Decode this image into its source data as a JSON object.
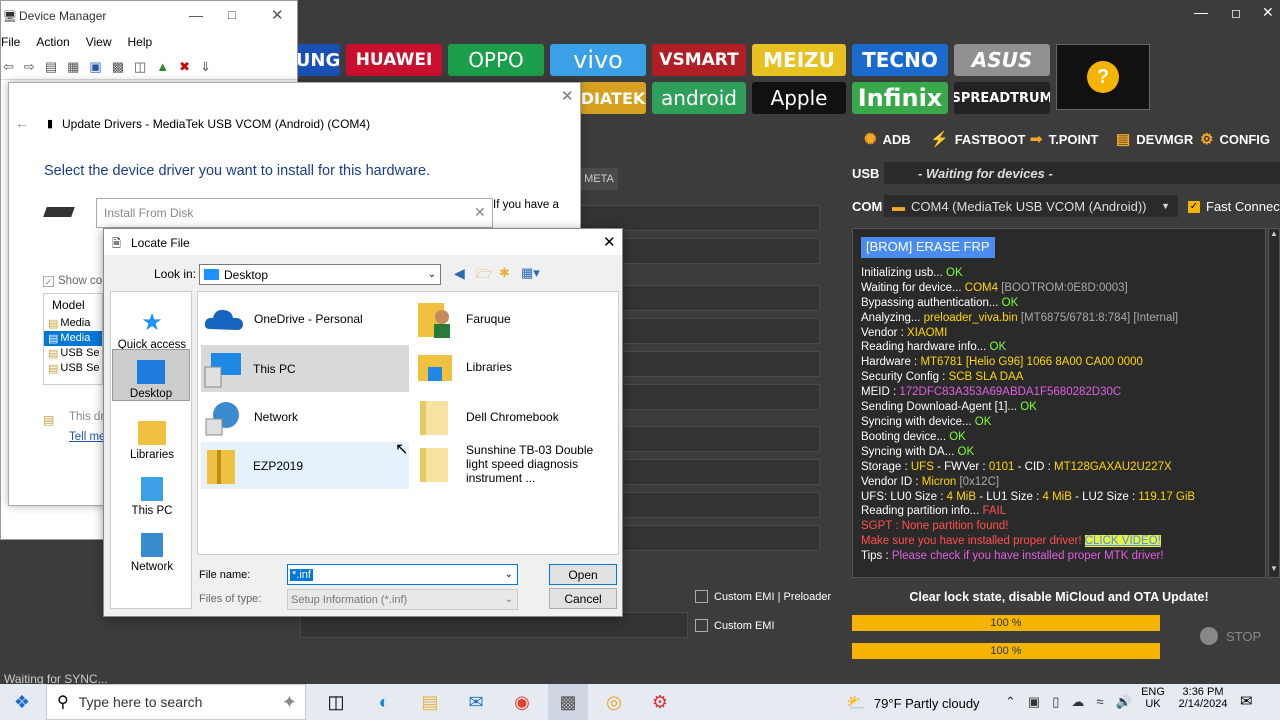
{
  "tool": {
    "brands": [
      "UNG",
      "HUAWEI",
      "OPPO",
      "vivo",
      "VSMART",
      "MEIZU",
      "TECNO",
      "ASUS",
      "DIATEK",
      "android",
      "Apple",
      "Infinix",
      "SPREADTRUM"
    ],
    "help_symbol": "?",
    "tabs": {
      "adb": "ADB",
      "fastboot": "FASTBOOT",
      "tpoint": "T.POINT",
      "devmgr": "DEVMGR",
      "config": "CONFIG"
    },
    "usb_label": "USB",
    "usb_value": "- Waiting for devices -",
    "com_label": "COM",
    "com_value": "COM4 (MediaTek USB VCOM (Android))",
    "fast_connect": "Fast Connect",
    "meta_tab": "META",
    "erase_button": "[BROM] ERASE FRP",
    "custom_emi_preloader": "Custom EMI | Preloader",
    "custom_emi": "Custom EMI",
    "clear_lock_text": "Clear lock state, disable MiCloud and OTA Update!",
    "progress1": "100 %",
    "progress2": "100 %",
    "stop_label": "STOP",
    "status_text": "Waiting for SYNC...",
    "log": [
      [
        [
          "Initializing usb... ",
          ""
        ],
        [
          "OK",
          "ok"
        ]
      ],
      [
        [
          "Waiting for device... ",
          ""
        ],
        [
          "COM4 ",
          "y"
        ],
        [
          "[BOOTROM:0E8D:0003]",
          "g"
        ]
      ],
      [
        [
          "Bypassing authentication... ",
          ""
        ],
        [
          "OK",
          "ok"
        ]
      ],
      [
        [
          "Analyzing... ",
          ""
        ],
        [
          "preloader_viva.bin ",
          "y"
        ],
        [
          "[MT6875/6781:8:784] [Internal]",
          "g"
        ]
      ],
      [
        [
          "Vendor : ",
          ""
        ],
        [
          "XIAOMI",
          "y"
        ]
      ],
      [
        [
          "Reading hardware info... ",
          ""
        ],
        [
          "OK",
          "ok"
        ]
      ],
      [
        [
          "  Hardware : ",
          ""
        ],
        [
          "MT6781 [Helio G96] 1066 8A00 CA00 0000",
          "y"
        ]
      ],
      [
        [
          "  Security Config : ",
          ""
        ],
        [
          "SCB SLA DAA",
          "y"
        ]
      ],
      [
        [
          "  MEID : ",
          ""
        ],
        [
          "172DFC83A353A69ABDA1F5680282D30C",
          "pk"
        ]
      ],
      [
        [
          "Sending Download-Agent [1]... ",
          ""
        ],
        [
          "OK",
          "ok"
        ]
      ],
      [
        [
          "Syncing with device... ",
          ""
        ],
        [
          "OK",
          "ok"
        ]
      ],
      [
        [
          "Booting device... ",
          ""
        ],
        [
          "OK",
          "ok"
        ]
      ],
      [
        [
          "Syncing with DA... ",
          ""
        ],
        [
          "OK",
          "ok"
        ]
      ],
      [
        [
          "  Storage : ",
          ""
        ],
        [
          "UFS",
          "y"
        ],
        [
          " - FWVer : ",
          ""
        ],
        [
          "0101",
          "y"
        ],
        [
          " - CID : ",
          ""
        ],
        [
          "MT128GAXAU2U227X",
          "y"
        ]
      ],
      [
        [
          "  Vendor ID : ",
          ""
        ],
        [
          "Micron ",
          "y"
        ],
        [
          "[0x12C]",
          "g"
        ]
      ],
      [
        [
          "  UFS: LU0 Size : ",
          ""
        ],
        [
          "4 MiB",
          "y"
        ],
        [
          " - LU1 Size : ",
          ""
        ],
        [
          "4 MiB",
          "y"
        ],
        [
          " - LU2 Size : ",
          ""
        ],
        [
          "119.17 GiB",
          "y"
        ]
      ],
      [
        [
          "Reading partition info... ",
          ""
        ],
        [
          "FAIL",
          "fail"
        ]
      ],
      [
        [
          "SGPT : None partition found!",
          "red"
        ]
      ],
      [
        [
          "Make sure you have installed proper driver! ",
          "red"
        ],
        [
          "CLICK VIDEO!",
          "link"
        ]
      ],
      [
        [
          "Tips : ",
          ""
        ],
        [
          "Please check if you have installed proper MTK driver!",
          "pk"
        ]
      ]
    ]
  },
  "devmgr": {
    "title": "Device Manager",
    "menu": [
      "File",
      "Action",
      "View",
      "Help"
    ],
    "tree": [
      "Media",
      "Media",
      "USB Se",
      "USB Se"
    ],
    "model_header": "Model",
    "show_compatible": "Show co",
    "info_text": "This dri",
    "tell_me": "Tell me"
  },
  "update_drivers": {
    "title": "Update Drivers - MediaTek USB VCOM (Android) (COM4)",
    "heading": "Select the device driver you want to install for this hardware.",
    "side_text": "If you have a"
  },
  "install_disk": {
    "title": "Install From Disk"
  },
  "locate": {
    "title": "Locate File",
    "look_in_label": "Look in:",
    "look_in_value": "Desktop",
    "places": [
      "Quick access",
      "Desktop",
      "Libraries",
      "This PC",
      "Network"
    ],
    "items": [
      {
        "name": "OneDrive - Personal"
      },
      {
        "name": "Faruque"
      },
      {
        "name": "This PC"
      },
      {
        "name": "Libraries"
      },
      {
        "name": "Network"
      },
      {
        "name": "Dell Chromebook"
      },
      {
        "name": "EZP2019"
      },
      {
        "name": "Sunshine TB-03 Double light speed diagnosis instrument ..."
      }
    ],
    "file_name_label": "File name:",
    "file_name_value": "*.inf",
    "file_type_label": "Files of type:",
    "file_type_value": "Setup Information (*.inf)",
    "open_button": "Open",
    "cancel_button": "Cancel"
  },
  "taskbar": {
    "search_placeholder": "Type here to search",
    "weather": "79°F  Partly cloudy",
    "lang": "ENG",
    "region": "UK",
    "time": "3:36 PM",
    "date": "2/14/2024"
  }
}
